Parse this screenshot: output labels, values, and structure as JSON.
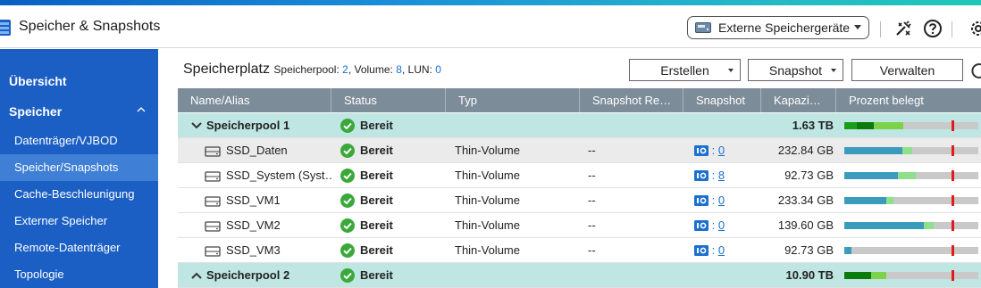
{
  "app": {
    "title": "Speicher & Snapshots"
  },
  "toolbar": {
    "external_label": "Externe Speichergeräte",
    "icons": [
      "drive-icon",
      "tools-icon",
      "help-icon",
      "settings-icon"
    ]
  },
  "sidebar": {
    "items": [
      {
        "label": "Übersicht",
        "level": "top"
      },
      {
        "label": "Speicher",
        "level": "top",
        "chevron": "up"
      },
      {
        "label": "Datenträger/VJBOD",
        "level": "sub"
      },
      {
        "label": "Speicher/Snapshots",
        "level": "sub",
        "active": true
      },
      {
        "label": "Cache-Beschleunigung",
        "level": "sub"
      },
      {
        "label": "Externer Speicher",
        "level": "sub"
      },
      {
        "label": "Remote-Datenträger",
        "level": "sub"
      },
      {
        "label": "Topologie",
        "level": "sub"
      }
    ]
  },
  "header": {
    "title": "Speicherplatz",
    "pool_label": "Speicherpool: ",
    "pool_count": "2",
    "volume_label": ", Volume: ",
    "volume_count": "8",
    "lun_label": ", LUN: ",
    "lun_count": "0"
  },
  "actions": {
    "create": "Erstellen",
    "snapshot": "Snapshot",
    "manage": "Verwalten"
  },
  "table": {
    "columns": [
      "Name/Alias",
      "Status",
      "Typ",
      "Snapshot Re…",
      "Snapshot",
      "Kapazi…",
      "Prozent belegt"
    ],
    "rows": [
      {
        "kind": "pool",
        "name": "Speicherpool 1",
        "expanded": true,
        "status": "Bereit",
        "capacity": "1.63 TB",
        "usage": [
          {
            "frac": 0.09,
            "color": "#1a9e1a"
          },
          {
            "frac": 0.13,
            "color": "#0c7a0c"
          },
          {
            "frac": 0.22,
            "color": "#7cd34a"
          }
        ],
        "threshold": 0.8
      },
      {
        "kind": "vol",
        "name": "SSD_Daten",
        "status": "Bereit",
        "type": "Thin-Volume",
        "snap_repl": "--",
        "snap_count": "0",
        "capacity": "232.84 GB",
        "usage": [
          {
            "frac": 0.43,
            "color": "#3a9bbd"
          },
          {
            "frac": 0.07,
            "color": "#8fe08a"
          }
        ],
        "threshold": 0.8,
        "shaded": true
      },
      {
        "kind": "vol",
        "name": "SSD_System (Syst…",
        "status": "Bereit",
        "type": "Thin-Volume",
        "snap_repl": "--",
        "snap_count": "8",
        "capacity": "92.73 GB",
        "usage": [
          {
            "frac": 0.4,
            "color": "#3a9bbd"
          },
          {
            "frac": 0.13,
            "color": "#8fe08a"
          }
        ],
        "threshold": 0.8
      },
      {
        "kind": "vol",
        "name": "SSD_VM1",
        "status": "Bereit",
        "type": "Thin-Volume",
        "snap_repl": "--",
        "snap_count": "0",
        "capacity": "233.34 GB",
        "usage": [
          {
            "frac": 0.31,
            "color": "#3a9bbd"
          },
          {
            "frac": 0.05,
            "color": "#8fe08a"
          }
        ],
        "threshold": 0.8
      },
      {
        "kind": "vol",
        "name": "SSD_VM2",
        "status": "Bereit",
        "type": "Thin-Volume",
        "snap_repl": "--",
        "snap_count": "0",
        "capacity": "139.60 GB",
        "usage": [
          {
            "frac": 0.59,
            "color": "#3a9bbd"
          },
          {
            "frac": 0.07,
            "color": "#8fe08a"
          }
        ],
        "threshold": 0.8
      },
      {
        "kind": "vol",
        "name": "SSD_VM3",
        "status": "Bereit",
        "type": "Thin-Volume",
        "snap_repl": "--",
        "snap_count": "0",
        "capacity": "92.73 GB",
        "usage": [
          {
            "frac": 0.05,
            "color": "#3a9bbd"
          }
        ],
        "threshold": 0.8
      },
      {
        "kind": "pool",
        "name": "Speicherpool 2",
        "expanded": false,
        "status": "Bereit",
        "capacity": "10.90 TB",
        "usage": [
          {
            "frac": 0.2,
            "color": "#0c7a0c"
          },
          {
            "frac": 0.11,
            "color": "#7cd34a"
          }
        ],
        "threshold": 0.8
      }
    ]
  },
  "colors": {
    "sidebar_bg": "#1b5fc4",
    "sidebar_active": "#3f7fd6",
    "table_header": "#7d8c99",
    "pool_row": "#bfe6e2",
    "threshold": "#e21a1a"
  }
}
